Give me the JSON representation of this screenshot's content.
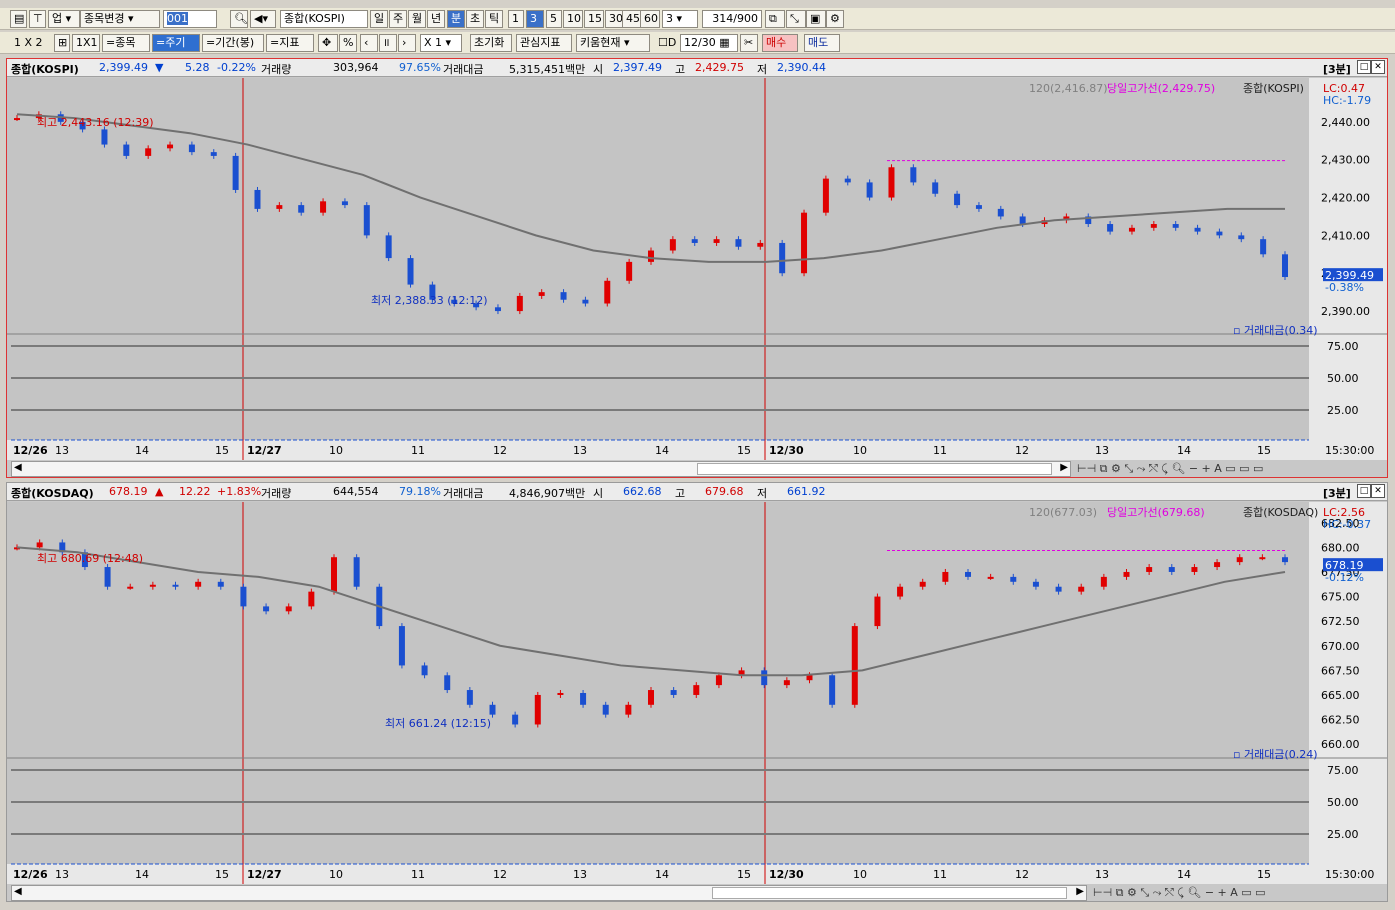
{
  "toolbar1": {
    "market": "업",
    "stock_change": "종목변경",
    "code": "001",
    "index_name": "종합(KOSPI)",
    "periods": [
      "일",
      "주",
      "월",
      "년",
      "분",
      "초",
      "틱"
    ],
    "active_period": "분",
    "intervals": [
      "1",
      "3",
      "5",
      "10",
      "15",
      "30",
      "45",
      "60"
    ],
    "active_interval": "3",
    "interval_select": "3",
    "count": "314",
    "count_total": "/900"
  },
  "toolbar2": {
    "layout": "1 X 2",
    "ratio": "1X1",
    "btn_stock": "=종목",
    "btn_period": "=주기",
    "btn_range": "=기간(봉)",
    "btn_indicator": "=지표",
    "percent": "%",
    "multiplier": "X 1",
    "reset": "초기화",
    "watch_indicator": "관심지표",
    "kiwoom": "키움현재",
    "date_check": "D",
    "date": "12/30",
    "buy": "매수",
    "sell": "매도"
  },
  "charts": [
    {
      "name": "종합(KOSPI)",
      "price": "2,399.49",
      "arrow": "▼",
      "change": "5.28",
      "change_pct": "-0.22%",
      "vol_label": "거래량",
      "volume": "303,964",
      "vol_pct": "97.65%",
      "amt_label": "거래대금",
      "amount": "5,315,451백만",
      "open_label": "시",
      "open": "2,397.49",
      "high_label": "고",
      "high": "2,429.75",
      "low_label": "저",
      "low": "2,390.44",
      "interval_badge": "[3분]",
      "legend_ma": "120(2,416.87)",
      "legend_high_line": "당일고가선(2,429.75)",
      "legend_name": "종합(KOSPI)",
      "lc": "LC:0.47",
      "hc": "HC:-1.79",
      "price_ticks": [
        "2,440.00",
        "2,430.00",
        "2,420.00",
        "2,410.00",
        "2,400.00",
        "2,390.00"
      ],
      "current_price_tag": "2,399.49",
      "current_pct_tag": "-0.38%",
      "max_label": "최고 2,443.16 (12:39)",
      "min_label": "최저 2,388.33 (12:12)",
      "sub_legend": "거래대금(0.34)",
      "sub_ticks": [
        "75.00",
        "50.00",
        "25.00"
      ],
      "time_labels": [
        "12/26",
        "13",
        "14",
        "15",
        "12/27",
        "10",
        "11",
        "12",
        "13",
        "14",
        "15",
        "12/30",
        "10",
        "11",
        "12",
        "13",
        "14",
        "15"
      ],
      "time_right": "15:30:00",
      "colors": {
        "up": "#e00000",
        "down": "#1a4fd0",
        "ma": "#707070",
        "high_line": "#e000e0",
        "session": "#d00000"
      },
      "chart_data": {
        "type": "line",
        "title": "",
        "xlabel": "",
        "ylabel": "",
        "ylim": [
          2385,
          2450
        ],
        "series": [
          {
            "name": "",
            "values": [
              2441,
              2442,
              2440,
              2438,
              2434,
              2431,
              2433,
              2434,
              2432,
              2431,
              2422,
              2417,
              2418,
              2416,
              2419,
              2418,
              2410,
              2404,
              2397,
              2393,
              2392,
              2391,
              2390,
              2394,
              2395,
              2393,
              2392,
              2398,
              2403,
              2406,
              2409,
              2408,
              2409,
              2407,
              2408,
              2400,
              2416,
              2425,
              2424,
              2420,
              2428,
              2424,
              2421,
              2418,
              2417,
              2415,
              2413,
              2414,
              2415,
              2413,
              2411,
              2412,
              2413,
              2412,
              2411,
              2410,
              2409,
              2405,
              2399
            ]
          },
          {
            "name": "",
            "values": [
              2442,
              2441,
              2439,
              2437,
              2434,
              2430,
              2426,
              2420,
              2415,
              2410,
              2406,
              2404,
              2403,
              2403,
              2404,
              2406,
              2409,
              2412,
              2414,
              2415,
              2416,
              2417,
              2417
            ]
          }
        ]
      }
    },
    {
      "name": "종합(KOSDAQ)",
      "price": "678.19",
      "arrow": "▲",
      "change": "12.22",
      "change_pct": "+1.83%",
      "vol_label": "거래량",
      "volume": "644,554",
      "vol_pct": "79.18%",
      "amt_label": "거래대금",
      "amount": "4,846,907백만",
      "open_label": "시",
      "open": "662.68",
      "high_label": "고",
      "high": "679.68",
      "low_label": "저",
      "low": "661.92",
      "interval_badge": "[3분]",
      "legend_ma": "120(677.03)",
      "legend_high_line": "당일고가선(679.68)",
      "legend_name": "종합(KOSDAQ)",
      "lc": "LC:2.56",
      "hc": "HC:-0.37",
      "price_ticks": [
        "682.50",
        "680.00",
        "677.50",
        "675.00",
        "672.50",
        "670.00",
        "667.50",
        "665.00",
        "662.50",
        "660.00"
      ],
      "current_price_tag": "678.19",
      "current_pct_tag": "-0.12%",
      "max_label": "최고 680.69 (12:48)",
      "min_label": "최저 661.24 (12:15)",
      "sub_legend": "거래대금(0.24)",
      "sub_ticks": [
        "75.00",
        "50.00",
        "25.00"
      ],
      "time_labels": [
        "12/26",
        "13",
        "14",
        "15",
        "12/27",
        "10",
        "11",
        "12",
        "13",
        "14",
        "15",
        "12/30",
        "10",
        "11",
        "12",
        "13",
        "14",
        "15"
      ],
      "time_right": "15:30:00",
      "colors": {
        "up": "#e00000",
        "down": "#1a4fd0",
        "ma": "#707070",
        "high_line": "#e000e0",
        "session": "#d00000"
      },
      "chart_data": {
        "type": "line",
        "title": "",
        "xlabel": "",
        "ylabel": "",
        "ylim": [
          659,
          684
        ],
        "series": [
          {
            "name": "",
            "values": [
              680,
              680.5,
              679.5,
              678,
              676,
              676,
              676.2,
              676,
              676.5,
              676,
              674,
              673.5,
              674,
              675.5,
              679,
              676,
              672,
              668,
              667,
              665.5,
              664,
              663,
              662,
              665,
              665.2,
              664,
              663,
              664,
              665.5,
              665,
              666,
              667,
              667.5,
              666,
              666.5,
              667,
              664,
              672,
              675,
              676,
              676.5,
              677.5,
              677,
              677,
              676.5,
              676,
              675.5,
              676,
              677,
              677.5,
              678,
              677.5,
              678,
              678.5,
              679,
              679,
              678.5
            ]
          },
          {
            "name": "",
            "values": [
              680,
              679.5,
              678.5,
              677.5,
              677,
              676,
              674,
              672,
              670,
              669,
              668,
              667.5,
              667,
              667,
              667.5,
              669,
              670.5,
              672,
              673.5,
              675,
              676.5,
              677.5
            ]
          }
        ]
      }
    }
  ]
}
